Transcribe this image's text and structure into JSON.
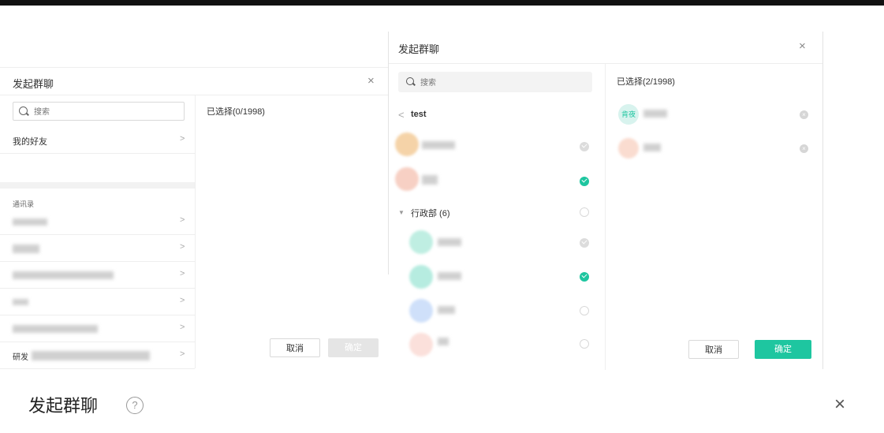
{
  "dialog_left": {
    "title": "发起群聊",
    "close": "×",
    "search_placeholder": "搜索",
    "my_friends": "我的好友",
    "contacts_header": "通讯录",
    "partial_label": "研发",
    "chevron": ">",
    "selected_label": "已选择(0/1998)",
    "cancel": "取消",
    "confirm": "确定"
  },
  "dialog_right": {
    "title": "发起群聊",
    "close": "×",
    "search_placeholder": "搜索",
    "back": "<",
    "breadcrumb": "test",
    "dept_caret": "▼",
    "dept": "行政部 (6)",
    "selected_label": "已选择(2/1998)",
    "selected_avatar_text": "肯夜",
    "remove": "×",
    "cancel": "取消",
    "confirm": "确定"
  },
  "bottom_header": {
    "title": "发起群聊",
    "help": "?",
    "close": "×"
  },
  "colors": {
    "accent": "#1ec6a0",
    "divider": "#eeeeee",
    "disabled_button": "#e5e5e5"
  }
}
